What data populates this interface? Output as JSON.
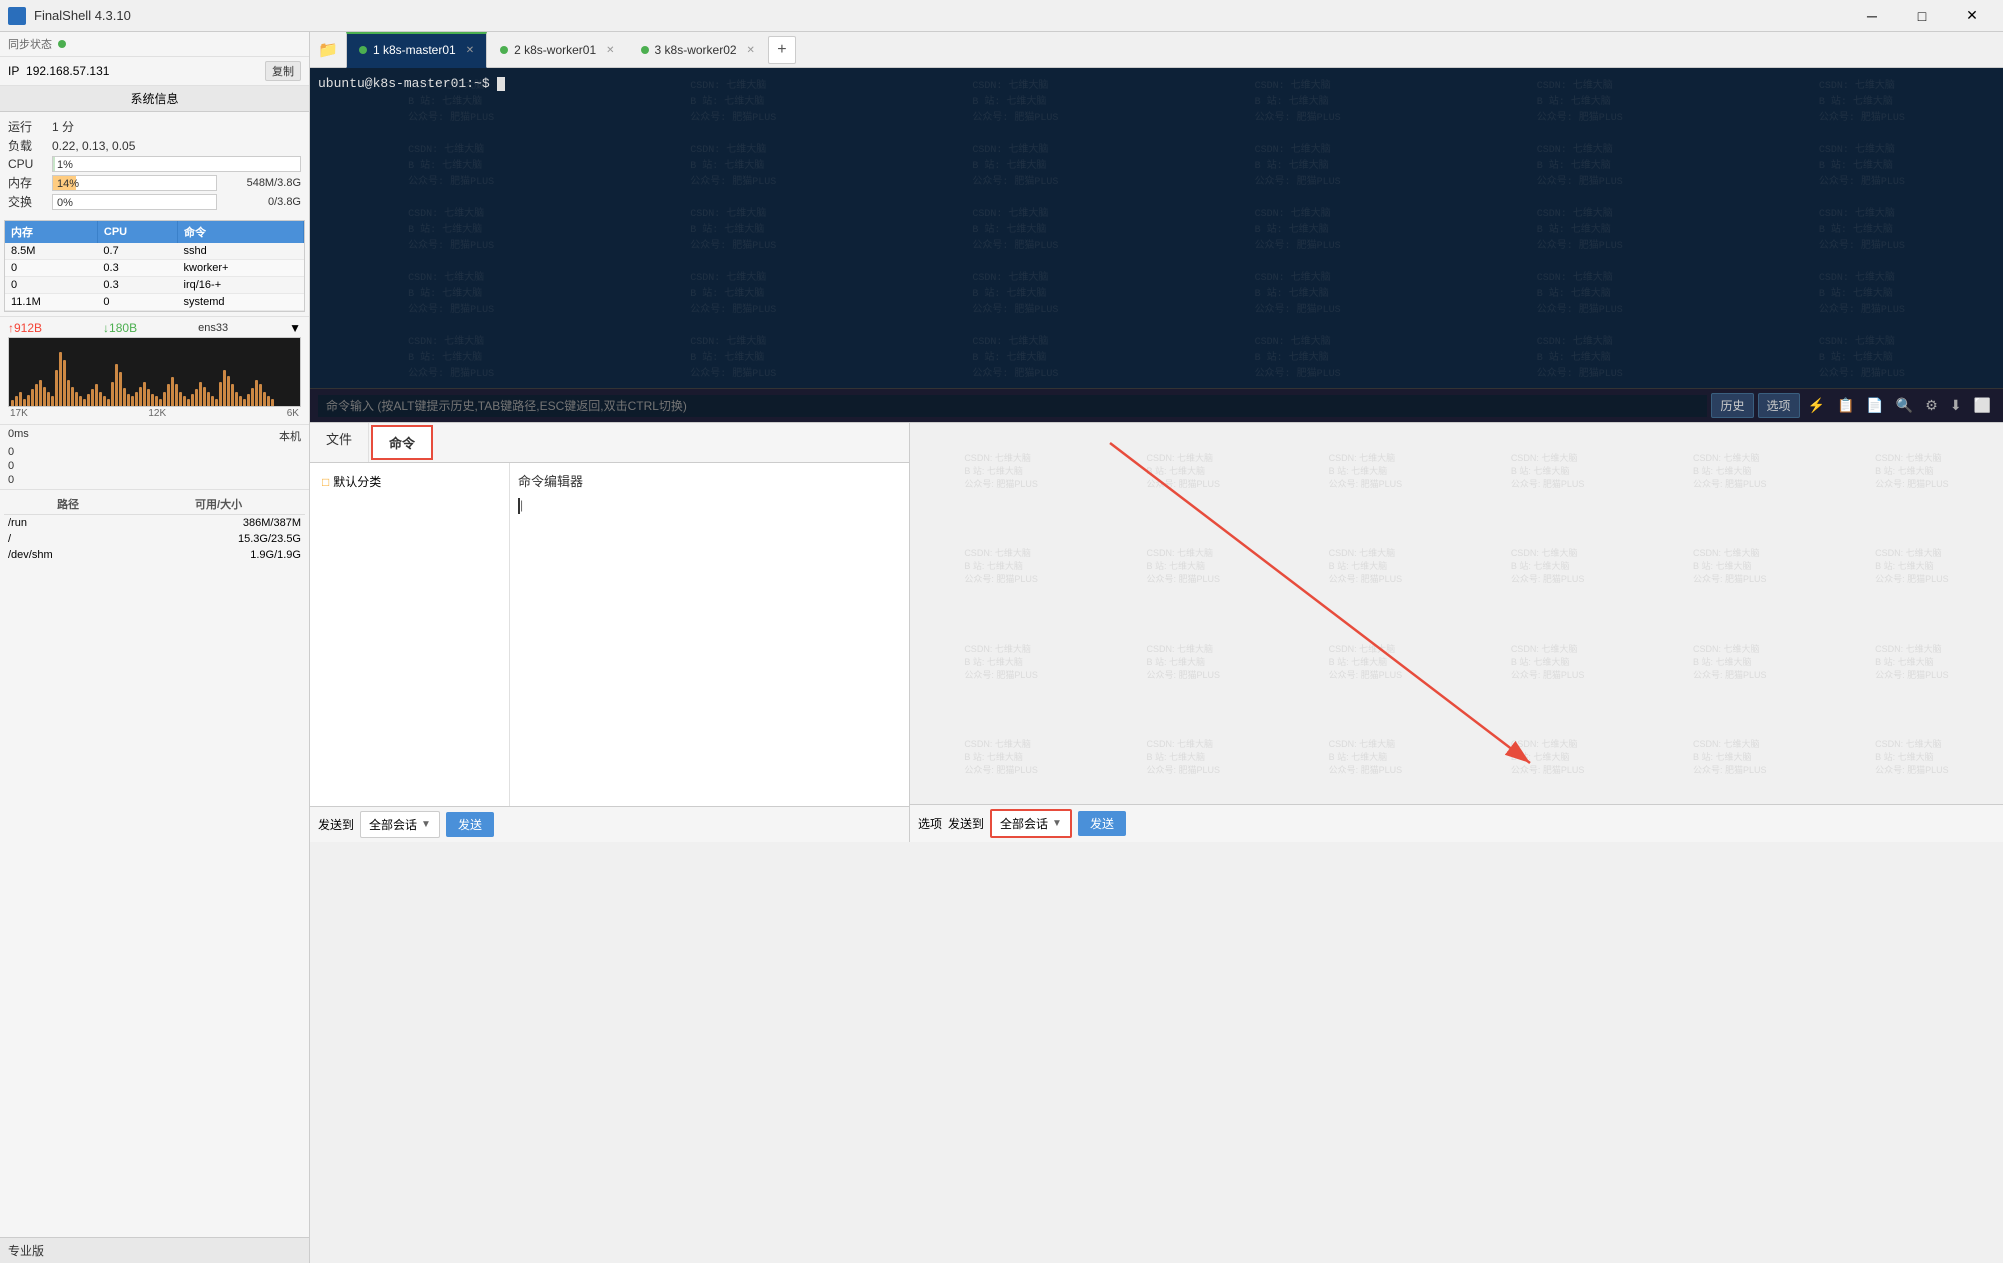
{
  "app": {
    "title": "FinalShell 4.3.10",
    "icon": "■"
  },
  "titlebar": {
    "minimize": "─",
    "maximize": "□",
    "close": "✕"
  },
  "sidebar": {
    "sync_label": "同步状态",
    "sync_status": "●",
    "ip_label": "IP",
    "ip_value": "192.168.57.131",
    "copy_label": "复制",
    "sysinfo_title": "系统信息",
    "run_time_label": "运行",
    "run_time_value": "1 分",
    "load_label": "负载",
    "load_value": "0.22, 0.13, 0.05",
    "cpu_label": "CPU",
    "cpu_value": "1%",
    "mem_label": "内存",
    "mem_value": "14%",
    "mem_size": "548M/3.8G",
    "swap_label": "交换",
    "swap_value": "0%",
    "swap_size": "0/3.8G",
    "proc_columns": [
      "内存",
      "CPU",
      "命令"
    ],
    "processes": [
      {
        "mem": "8.5M",
        "cpu": "0.7",
        "cmd": "sshd"
      },
      {
        "mem": "0",
        "cpu": "0.3",
        "cmd": "kworker+"
      },
      {
        "mem": "0",
        "cpu": "0.3",
        "cmd": "irq/16-+"
      },
      {
        "mem": "11.1M",
        "cpu": "0",
        "cmd": "systemd"
      }
    ],
    "net_up": "↑912B",
    "net_down": "↓180B",
    "net_interface": "ens33",
    "net_graph_levels": [
      "17K",
      "12K",
      "6K"
    ],
    "latency_label": "0ms",
    "latency_target": "本机",
    "latency_rows": [
      {
        "label": "",
        "value": "0"
      },
      {
        "label": "",
        "value": "0"
      },
      {
        "label": "",
        "value": "0"
      }
    ],
    "disk_columns": [
      "路径",
      "可用/大小"
    ],
    "disk_rows": [
      {
        "path": "/run",
        "avail": "386M/387M"
      },
      {
        "path": "/",
        "avail": "15.3G/23.5G"
      },
      {
        "path": "/dev/shm",
        "avail": "1.9G/1.9G"
      }
    ],
    "edition": "专业版"
  },
  "tabs": [
    {
      "id": 1,
      "label": "1  k8s-master01",
      "active": true,
      "dot_color": "green"
    },
    {
      "id": 2,
      "label": "2  k8s-worker01",
      "active": false,
      "dot_color": "green"
    },
    {
      "id": 3,
      "label": "3  k8s-worker02",
      "active": false,
      "dot_color": "green"
    }
  ],
  "terminal": {
    "prompt": "ubuntu@k8s-master01:~$"
  },
  "cmd_input": {
    "placeholder": "命令输入 (按ALT键提示历史,TAB键路径,ESC键返回,双击CTRL切换)",
    "history_btn": "历史",
    "options_btn": "选项"
  },
  "bottom_panel": {
    "file_tab": "文件",
    "cmd_tab": "命令",
    "cmd_editor_title": "命令编辑器",
    "default_category": "□ 默认分类"
  },
  "send_bar_left": {
    "send_to_label": "发送到",
    "send_to_value": "全部会话",
    "send_btn": "发送"
  },
  "send_bar_right": {
    "options_label": "选项",
    "send_to_label": "发送到",
    "send_to_value": "全部会话",
    "send_btn": "发送"
  },
  "watermark": {
    "line1": "CSDN: 七维大脑",
    "line2": "B 站: 七维大脑",
    "line3": "公众号: 肥猫PLUS"
  }
}
